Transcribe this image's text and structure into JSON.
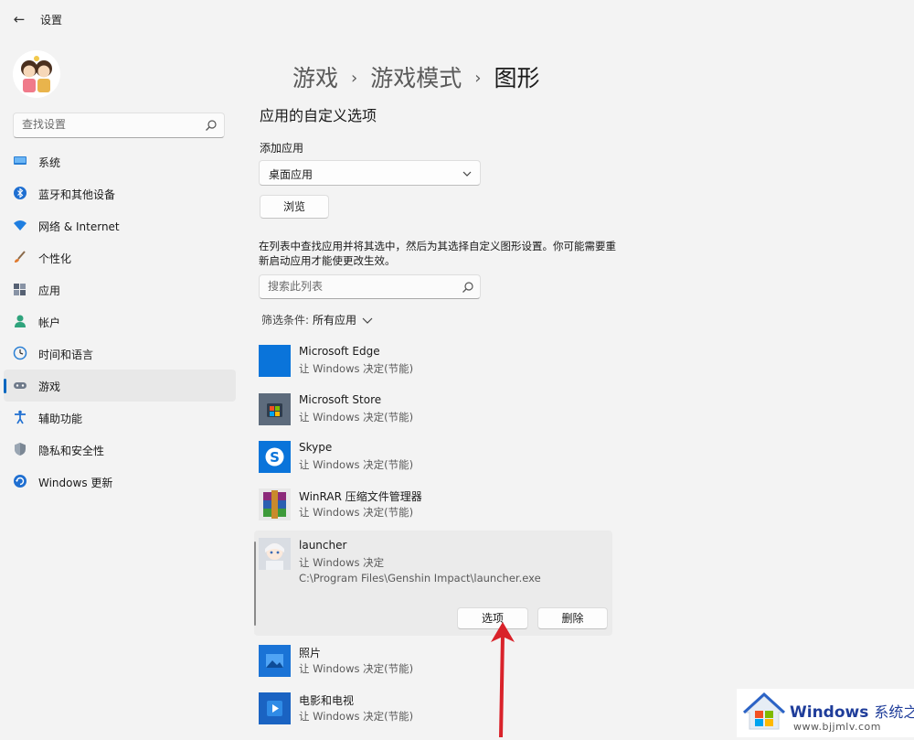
{
  "window": {
    "title": "设置"
  },
  "sidebar": {
    "search_placeholder": "查找设置",
    "items": [
      {
        "label": "系统",
        "icon": "monitor-icon"
      },
      {
        "label": "蓝牙和其他设备",
        "icon": "bluetooth-icon"
      },
      {
        "label": "网络 & Internet",
        "icon": "wifi-icon"
      },
      {
        "label": "个性化",
        "icon": "brush-icon"
      },
      {
        "label": "应用",
        "icon": "apps-icon"
      },
      {
        "label": "帐户",
        "icon": "person-icon"
      },
      {
        "label": "时间和语言",
        "icon": "globe-clock-icon"
      },
      {
        "label": "游戏",
        "icon": "gamepad-icon",
        "active": true
      },
      {
        "label": "辅助功能",
        "icon": "accessibility-icon"
      },
      {
        "label": "隐私和安全性",
        "icon": "shield-icon"
      },
      {
        "label": "Windows 更新",
        "icon": "update-icon"
      }
    ]
  },
  "breadcrumb": [
    "游戏",
    "游戏模式",
    "图形"
  ],
  "main": {
    "section_title": "应用的自定义选项",
    "add_app_label": "添加应用",
    "app_type_selected": "桌面应用",
    "browse_label": "浏览",
    "description": "在列表中查找应用并将其选中，然后为其选择自定义图形设置。你可能需要重新启动应用才能使更改生效。",
    "list_search_placeholder": "搜索此列表",
    "filter_label": "筛选条件:",
    "filter_value": "所有应用"
  },
  "apps": [
    {
      "name": "Microsoft Edge",
      "preference": "让 Windows 决定(节能)",
      "icon": "edge-icon"
    },
    {
      "name": "Microsoft Store",
      "preference": "让 Windows 决定(节能)",
      "icon": "store-icon"
    },
    {
      "name": "Skype",
      "preference": "让 Windows 决定(节能)",
      "icon": "skype-icon"
    },
    {
      "name": "WinRAR 压缩文件管理器",
      "preference": "让 Windows 决定(节能)",
      "icon": "winrar-icon"
    }
  ],
  "selected_app": {
    "name": "launcher",
    "preference": "让 Windows 决定",
    "path": "C:\\Program Files\\Genshin Impact\\launcher.exe",
    "options_label": "选项",
    "delete_label": "删除",
    "icon": "launcher-icon"
  },
  "apps_after": [
    {
      "name": "照片",
      "preference": "让 Windows 决定(节能)",
      "icon": "photos-icon"
    },
    {
      "name": "电影和电视",
      "preference": "让 Windows 决定(节能)",
      "icon": "movies-icon"
    }
  ],
  "watermark": {
    "title": "Windows",
    "title_cn": "系统之家",
    "url": "www.bjjmlv.com"
  },
  "colors": {
    "accent": "#0067c0",
    "arrow": "#d9222a",
    "background": "#f3f3f3"
  }
}
